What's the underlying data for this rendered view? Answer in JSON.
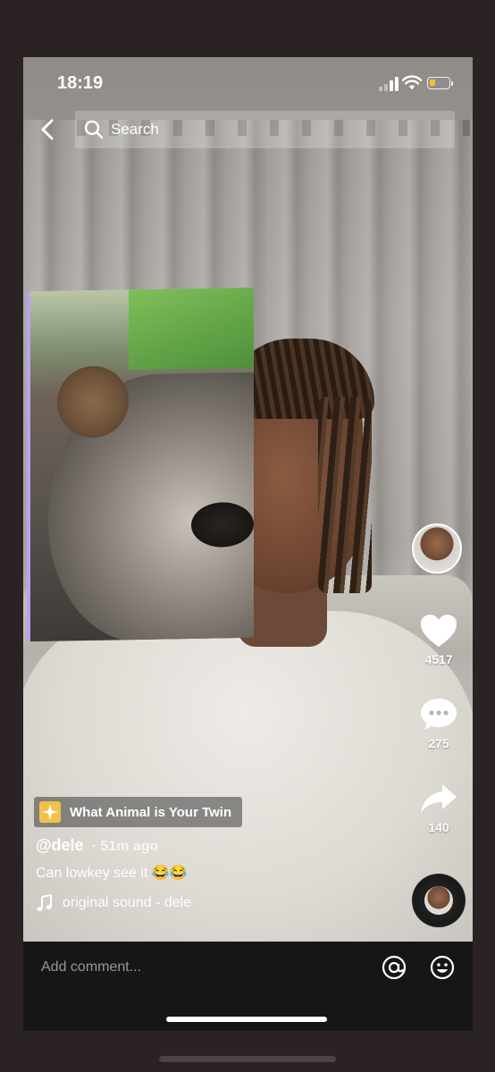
{
  "status_bar": {
    "time": "18:19",
    "battery_level": 0.3,
    "battery_color": "#f2c230"
  },
  "search": {
    "placeholder": "Search"
  },
  "icons": {
    "back": "chevron-left-icon",
    "search": "search-icon",
    "like": "heart-icon",
    "comment": "speech-bubble-icon",
    "share": "share-arrow-icon",
    "sound": "music-note-icon",
    "mention": "at-sign-icon",
    "emoji": "smiley-icon"
  },
  "actions": {
    "likes": "4517",
    "comments": "275",
    "shares": "140"
  },
  "effect": {
    "label": "What Animal is Your Twin"
  },
  "post": {
    "username": "@dele",
    "time_ago": "· 51m ago",
    "caption": "Can lowkey see it 😂😂",
    "sound": "original sound - dele"
  },
  "comment_bar": {
    "placeholder": "Add comment..."
  }
}
